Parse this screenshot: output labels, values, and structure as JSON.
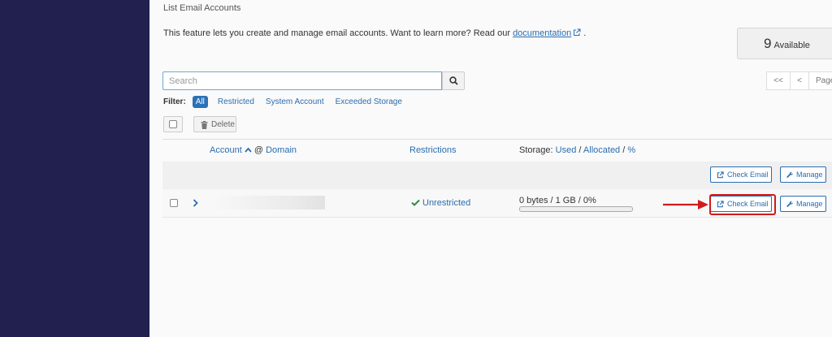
{
  "page": {
    "title": "List Email Accounts",
    "description_prefix": "This feature lets you create and manage email accounts. Want to learn more? Read our",
    "description_link": "documentation",
    "description_suffix": "."
  },
  "available": {
    "count": "9",
    "label": "Available"
  },
  "search": {
    "placeholder": "Search",
    "value": ""
  },
  "pagination": {
    "first": "<<",
    "prev": "<",
    "page_label": "Page"
  },
  "filter": {
    "label": "Filter:",
    "options": [
      "All",
      "Restricted",
      "System Account",
      "Exceeded Storage"
    ],
    "selected": "All"
  },
  "bulk": {
    "delete_label": "Delete"
  },
  "table": {
    "columns": {
      "account": "Account",
      "at": "@",
      "domain": "Domain",
      "restrictions": "Restrictions",
      "storage_prefix": "Storage:",
      "storage_used": "Used",
      "slash1": "/",
      "storage_allocated": "Allocated",
      "slash2": "/",
      "storage_percent": "%"
    },
    "system_row": {
      "check_email": "Check Email",
      "manage": "Manage"
    },
    "rows": [
      {
        "account": "",
        "restriction": "Unrestricted",
        "storage": "0 bytes / 1 GB / 0%",
        "storage_fraction": 0,
        "check_email": "Check Email",
        "manage": "Manage"
      }
    ]
  },
  "colors": {
    "sidebar": "#22204f",
    "link": "#2a6db0",
    "accent": "#2c72b6",
    "highlight": "#d01c1c",
    "success": "#2e8b3a"
  }
}
